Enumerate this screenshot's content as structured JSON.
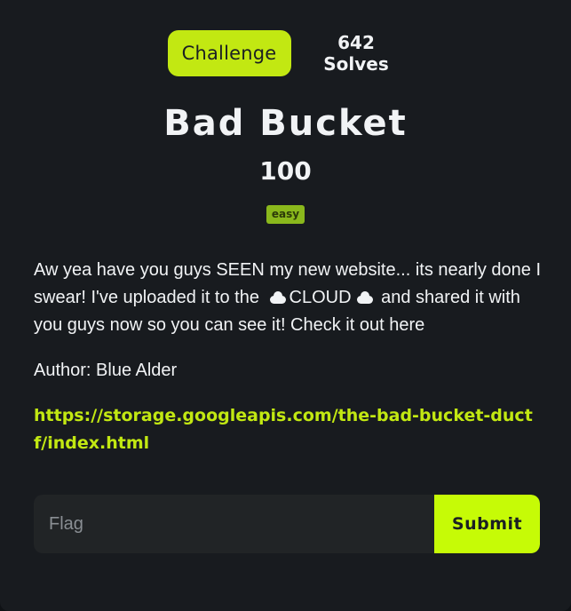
{
  "tabs": {
    "challenge_label": "Challenge",
    "solves_label": "642 Solves"
  },
  "challenge": {
    "title": "Bad Bucket",
    "points": "100",
    "difficulty": "easy",
    "description_line_a": "Aw yea have you guys SEEN my new website... its nearly done I swear! I've uploaded it to the",
    "cloud_word": "CLOUD",
    "description_line_b": "and shared it with you guys now so you can see it! Check it out here",
    "author": "Author: Blue Alder",
    "link": "https://storage.googleapis.com/the-bad-bucket-ductf/index.html"
  },
  "flag_form": {
    "placeholder": "Flag",
    "value": "",
    "submit_label": "Submit"
  },
  "colors": {
    "accent": "#c2e812",
    "submit": "#c6fb06",
    "background": "#181b1f",
    "input_bg": "#212426",
    "tag_easy": "#8ab81c"
  },
  "icons": {
    "cloud": "cloud-icon"
  }
}
